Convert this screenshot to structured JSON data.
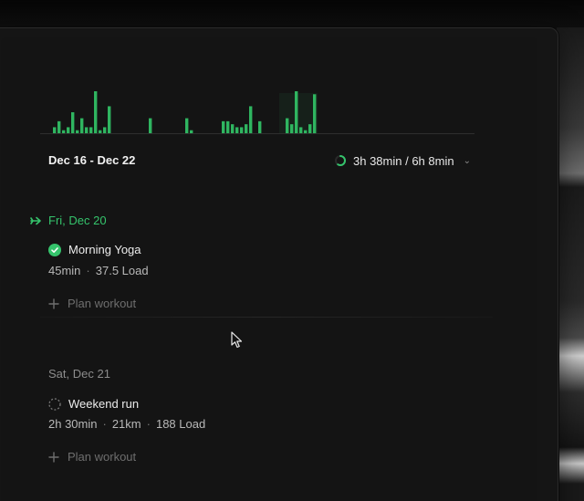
{
  "colors": {
    "accent": "#35c46c",
    "bar": "#2fb560",
    "background": "#141414",
    "muted_text": "#8c8c8c"
  },
  "week": {
    "range": "Dec 16 - Dec 22",
    "total": "3h 38min / 6h 8min",
    "progress_fraction": 0.59
  },
  "chart_data": {
    "type": "bar",
    "values": [
      2,
      4,
      1,
      2,
      7,
      1,
      5,
      2,
      2,
      14,
      1,
      2,
      9,
      0,
      0,
      0,
      0,
      0,
      0,
      0,
      0,
      5,
      0,
      0,
      0,
      0,
      0,
      0,
      0,
      5,
      1,
      0,
      0,
      0,
      0,
      0,
      0,
      4,
      4,
      3,
      2,
      2,
      3,
      9,
      0,
      4,
      0,
      0,
      0,
      0,
      0,
      5,
      3,
      14,
      2,
      1,
      3,
      13
    ],
    "highlight_from_index": 50
  },
  "days": [
    {
      "label": "Fri, Dec 20",
      "state": "today",
      "icon": "today-arrow-icon",
      "workouts": [
        {
          "title": "Morning Yoga",
          "status": "completed",
          "duration": "45min",
          "distance": "",
          "load": "37.5 Load"
        }
      ],
      "plan_label": "Plan workout"
    },
    {
      "label": "Sat, Dec 21",
      "state": "future",
      "workouts": [
        {
          "title": "Weekend run",
          "status": "planned",
          "duration": "2h 30min",
          "distance": "21km",
          "load": "188 Load"
        }
      ],
      "plan_label": "Plan workout"
    }
  ],
  "separator": "·"
}
